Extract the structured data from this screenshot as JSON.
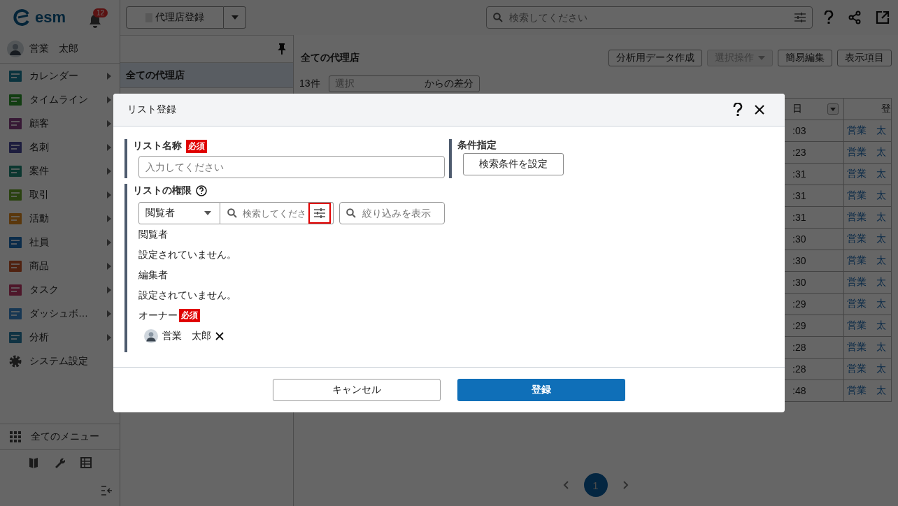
{
  "sidebar": {
    "logo": "esm",
    "notification_count": "12",
    "user": {
      "name": "営業　太郎"
    },
    "menu": [
      {
        "label": "カレンダー",
        "submenu": true
      },
      {
        "label": "タイムライン",
        "submenu": true
      },
      {
        "label": "顧客",
        "submenu": true
      },
      {
        "label": "名刺",
        "submenu": true
      },
      {
        "label": "案件",
        "submenu": true
      },
      {
        "label": "取引",
        "submenu": true
      },
      {
        "label": "活動",
        "submenu": true
      },
      {
        "label": "社員",
        "submenu": true
      },
      {
        "label": "商品",
        "submenu": true
      },
      {
        "label": "タスク",
        "submenu": true
      },
      {
        "label": "ダッシュボ…",
        "submenu": true
      },
      {
        "label": "分析",
        "submenu": true
      },
      {
        "label": "システム設定",
        "submenu": false
      }
    ],
    "all_menu": "全てのメニュー"
  },
  "top_bar": {
    "view_button": "代理店登録",
    "search": {
      "placeholder": "検索してください"
    }
  },
  "list_panel": {
    "items": [
      {
        "label": "全ての代理店",
        "selected": true
      }
    ]
  },
  "main": {
    "title": "全ての代理店",
    "actions": [
      {
        "label": "分析用データ作成",
        "disabled": false
      },
      {
        "label": "選択操作",
        "disabled": true
      },
      {
        "label": "簡易編集",
        "disabled": false
      },
      {
        "label": "表示項目",
        "disabled": false
      }
    ],
    "count": "13件",
    "diff": {
      "placeholder": "選択",
      "suffix": "からの差分"
    },
    "table": {
      "columns": [
        "日",
        "登"
      ],
      "rows": [
        {
          "date": ":03",
          "user": "営業　太"
        },
        {
          "date": ":23",
          "user": "営業　太"
        },
        {
          "date": ":31",
          "user": "営業　太"
        },
        {
          "date": ":31",
          "user": "営業　太"
        },
        {
          "date": ":31",
          "user": "営業　太"
        },
        {
          "date": ":30",
          "user": "営業　太"
        },
        {
          "date": ":30",
          "user": "営業　太"
        },
        {
          "date": ":30",
          "user": "営業　太"
        },
        {
          "date": ":29",
          "user": "営業　太"
        },
        {
          "date": ":29",
          "user": "営業　太"
        },
        {
          "date": ":28",
          "user": "営業　太"
        },
        {
          "date": ":28",
          "user": "営業　太"
        },
        {
          "date": ":48",
          "user": "営業　太"
        }
      ]
    },
    "pagination": [
      {
        "label": "1",
        "selected": true
      }
    ]
  },
  "dialog": {
    "title": "リスト登録",
    "name_field": {
      "label": "リスト名称",
      "badge": "必須",
      "placeholder": "入力してください"
    },
    "condition": {
      "label": "条件指定",
      "button": "検索条件を設定"
    },
    "permissions": {
      "label": "リストの権限",
      "role_select": "閲覧者",
      "search": {
        "placeholder": "検索してくださ"
      },
      "filter_highlighted": true,
      "filter_field": {
        "placeholder": "絞り込みを表示"
      },
      "groups": [
        {
          "label": "閲覧者",
          "empty_text": "設定されていません。"
        },
        {
          "label": "編集者",
          "empty_text": "設定されていません。"
        },
        {
          "label": "オーナー",
          "badge": "必須",
          "members": [
            {
              "name": "営業　太郎"
            }
          ]
        }
      ]
    },
    "buttons": [
      {
        "label": "キャンセル",
        "kind": "secondary"
      },
      {
        "label": "登録",
        "kind": "primary"
      }
    ]
  }
}
